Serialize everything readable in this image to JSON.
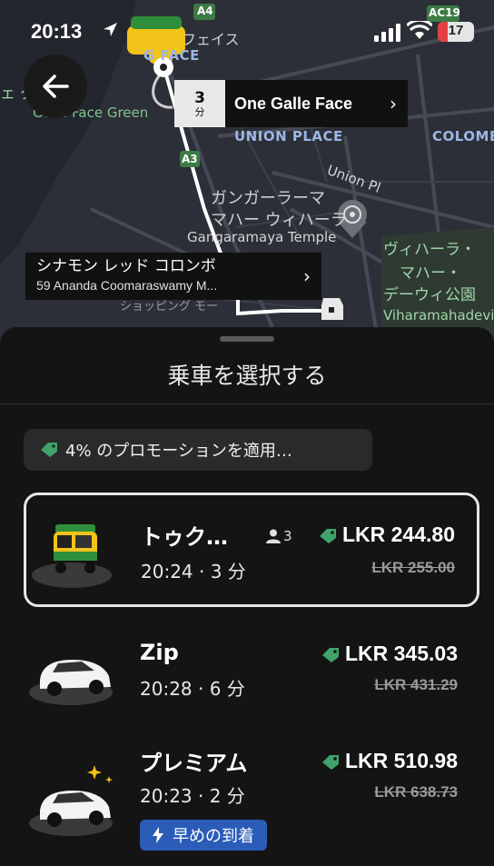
{
  "status_bar": {
    "time": "20:13",
    "battery": "17"
  },
  "map": {
    "labels": {
      "a4": "A4",
      "ac19": "AC19",
      "a3": "A3",
      "galle_face_jp": "フェイス",
      "galle_face_en": "G  FACE",
      "green_jp": "ェ   グリーン",
      "green_en": "Galle Face Green",
      "union_place": "UNION PLACE",
      "colombo": "COLOMB",
      "union_pl": "Union Pl",
      "temple_jp_1": "ガンガーラーマ",
      "temple_jp_2": "マハー ウィハーラ",
      "temple_en": "Gangaramaya Temple",
      "vihara_jp_1": "ヴィハーラ・",
      "vihara_jp_2": "マハー・",
      "vihara_jp_3": "デーウィ公園",
      "vihara_en": "Viharamahadevi",
      "shopping_jp": "ショッピング モー"
    },
    "destination": {
      "eta_value": "3",
      "eta_unit": "分",
      "name": "One Galle Face"
    },
    "pickup": {
      "title": "シナモン レッド コロンボ",
      "address": "59 Ananda Coomaraswamy M..."
    }
  },
  "sheet": {
    "title": "乗車を選択する",
    "promo": "4% のプロモーションを適用…",
    "rides": [
      {
        "name": "トゥク…",
        "time": "20:24 · 3 分",
        "seats": "3",
        "price": "LKR 244.80",
        "old_price": "LKR 255.00",
        "selected": true
      },
      {
        "name": "Zip",
        "time": "20:28 · 6 分",
        "price": "LKR 345.03",
        "old_price": "LKR 431.29"
      },
      {
        "name": "プレミアム",
        "time": "20:23 · 2 分",
        "price": "LKR 510.98",
        "old_price": "LKR 638.73",
        "badge": "早めの到着"
      }
    ]
  },
  "colors": {
    "promo_tag": "#3fa36b",
    "badge_blue": "#2a5cb8",
    "tuk_yellow": "#f2c318",
    "tuk_green": "#2f8f3c"
  },
  "icons": [
    "location-arrow-icon",
    "signal-icon",
    "wifi-icon",
    "battery-icon",
    "back-arrow-icon",
    "chevron-right-icon",
    "promo-tag-icon",
    "person-icon",
    "lightning-icon",
    "dharma-wheel-icon"
  ]
}
